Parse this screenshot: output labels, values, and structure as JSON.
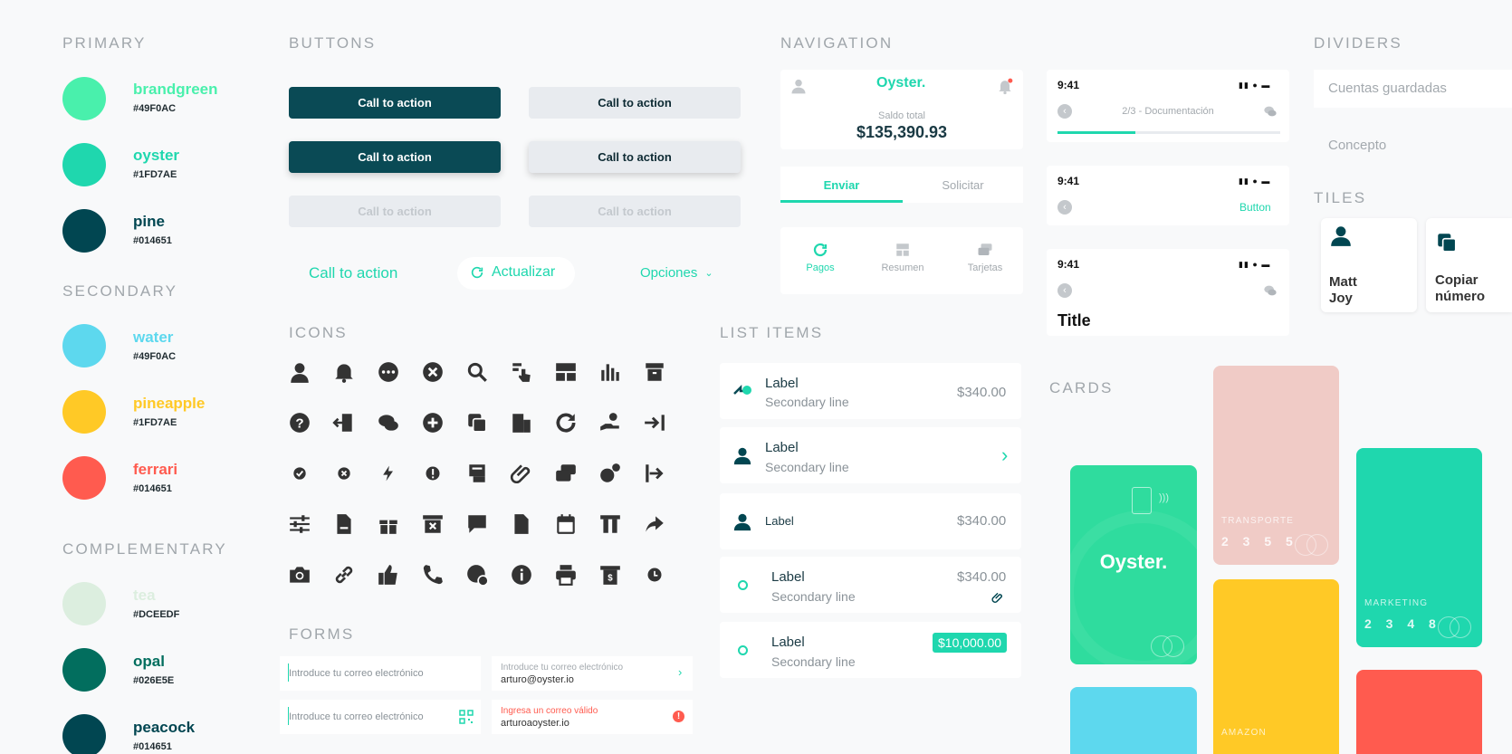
{
  "sections": {
    "primary": "PRIMARY",
    "secondary": "SECONDARY",
    "complementary": "COMPLEMENTARY",
    "buttons": "BUTTONS",
    "icons": "ICONS",
    "forms": "FORMS",
    "navigation": "NAVIGATION",
    "list_items": "LIST ITEMS",
    "dividers": "DIVIDERS",
    "tiles": "TILES",
    "cards": "CARDS"
  },
  "colors": {
    "primary": [
      {
        "name": "brandgreen",
        "hex": "#49F0AC",
        "swatch": "#49f0ac"
      },
      {
        "name": "oyster",
        "hex": "#1FD7AE",
        "swatch": "#1fd7ae"
      },
      {
        "name": "pine",
        "hex": "#014651",
        "swatch": "#014651"
      }
    ],
    "secondary": [
      {
        "name": "water",
        "hex": "#49F0AC",
        "swatch": "#5dd8ee"
      },
      {
        "name": "pineapple",
        "hex": "#1FD7AE",
        "swatch": "#ffc926"
      },
      {
        "name": "ferrari",
        "hex": "#014651",
        "swatch": "#ff5b4f"
      }
    ],
    "complementary": [
      {
        "name": "tea",
        "hex": "#DCEEDF",
        "swatch": "#dceedf"
      },
      {
        "name": "opal",
        "hex": "#026E5E",
        "swatch": "#026e5e"
      },
      {
        "name": "peacock",
        "hex": "#014651",
        "swatch": "#014651"
      }
    ]
  },
  "buttons": {
    "cta": "Call to action",
    "refresh": "Actualizar",
    "options": "Opciones"
  },
  "icon_names": [
    "user-icon",
    "bell-icon",
    "more-icon",
    "close-circle-icon",
    "search-icon",
    "tap-icon",
    "layout-icon",
    "bar-chart-icon",
    "box-icon",
    "help-icon",
    "logout-icon",
    "chat-icon",
    "add-icon",
    "copy-icon",
    "building-icon",
    "refresh-icon",
    "hand-coin-icon",
    "arrow-right-bar-icon",
    "check-icon",
    "close-small-icon",
    "bolt-icon",
    "alert-icon",
    "receipt-icon",
    "attach-icon",
    "cards-icon",
    "coin-icon",
    "exit-icon",
    "sliders-icon",
    "document-icon",
    "gift-icon",
    "archive-x-icon",
    "comment-icon",
    "file-icon",
    "calendar-icon",
    "reader-icon",
    "share-icon",
    "camera-icon",
    "link-icon",
    "like-icon",
    "phone-icon",
    "globe-coin-icon",
    "info-icon",
    "print-icon",
    "invoice-icon",
    "clock-icon"
  ],
  "forms": {
    "email_placeholder": "Introduce tu correo electrónico",
    "email_label": "Introduce tu correo electrónico",
    "email_value": "arturo@oyster.io",
    "error_label": "Ingresa un correo válido",
    "error_value": "arturoaoyster.io"
  },
  "navigation": {
    "brand": "Oyster.",
    "balance_label": "Saldo total",
    "balance": "$135,390.93",
    "tab_send": "Enviar",
    "tab_request": "Solicitar",
    "bottom_pay": "Pagos",
    "bottom_summary": "Resumen",
    "bottom_cards": "Tarjetas",
    "time": "9:41",
    "step": "2/3 - Documentación",
    "step_progress": 0.35,
    "button": "Button",
    "title": "Title"
  },
  "list_items": {
    "label": "Label",
    "secondary": "Secondary line",
    "amount": "$340.00",
    "amount_big": "$10,000.00"
  },
  "dividers": {
    "saved_accounts": "Cuentas guardadas",
    "concept": "Concepto"
  },
  "tiles": {
    "person": "Matt Joy",
    "copy": "Copiar número"
  },
  "cards": {
    "brand": "Oyster.",
    "transport": "TRANSPORTE",
    "transport_num": "2 3 5 5",
    "marketing": "MARKETING",
    "marketing_num": "2 3 4 8",
    "amazon": "AMAZON"
  }
}
